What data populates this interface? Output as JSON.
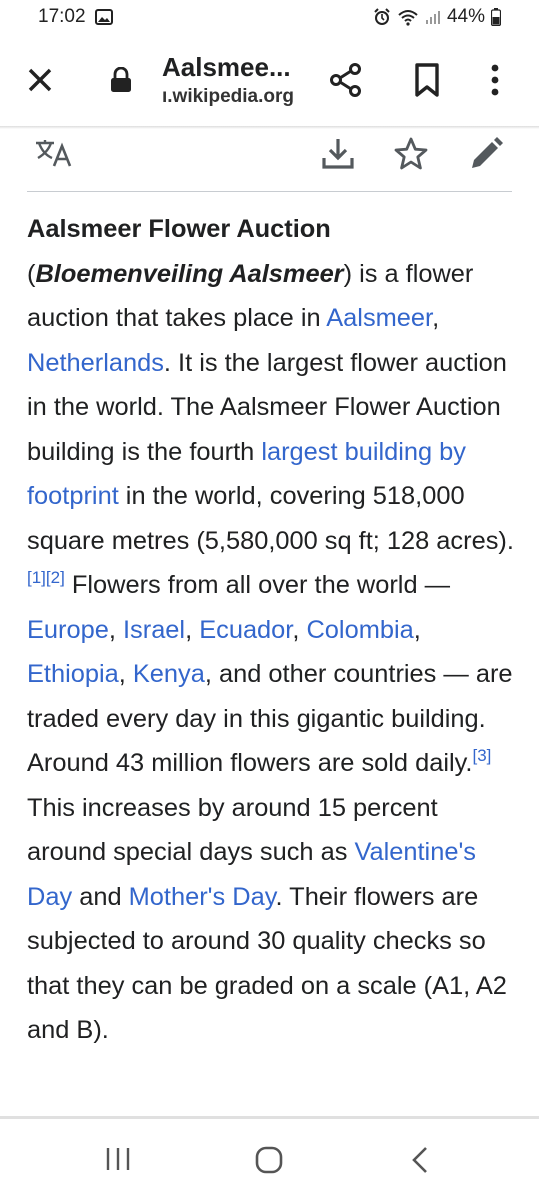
{
  "status_bar": {
    "time": "17:02",
    "battery": "44%"
  },
  "toolbar": {
    "title": "Aalsmee...",
    "url": "ı.wikipedia.org"
  },
  "article": {
    "title_bold": "Aalsmeer Flower Auction",
    "native_name": "Bloemenveiling Aalsmeer",
    "p1": ") is a flower auction that takes place in ",
    "link_aalsmeer": "Aalsmeer",
    "comma1": ", ",
    "link_netherlands": "Netherlands",
    "p2": ". It is the largest flower auction in the world. The Aalsmeer Flower Auction building is the fourth ",
    "link_largest_building": "largest building by footprint",
    "p3": " in the world, covering 518,000 square metres (5,580,000 sq ft; 128 acres).",
    "ref1": "[1]",
    "ref2": "[2]",
    "p4": " Flowers from all over the world — ",
    "link_europe": "Europe",
    "link_israel": "Israel",
    "link_ecuador": "Ecuador",
    "link_colombia": "Colombia",
    "link_ethiopia": "Ethiopia",
    "link_kenya": "Kenya",
    "p5": ", and other countries — are traded every day in this gigantic building. Around 43 million flowers are sold daily.",
    "ref3": "[3]",
    "p6": " This increases by around 15 percent around special days such as ",
    "link_valentines": "Valentine's Day",
    "p7": " and ",
    "link_mothers": "Mother's Day",
    "p8": ". Their flowers are subjected to around 30 quality checks so that they can be graded on a scale (A1, A2 and B)."
  },
  "colors": {
    "link": "#3366cc",
    "text": "#202122"
  }
}
